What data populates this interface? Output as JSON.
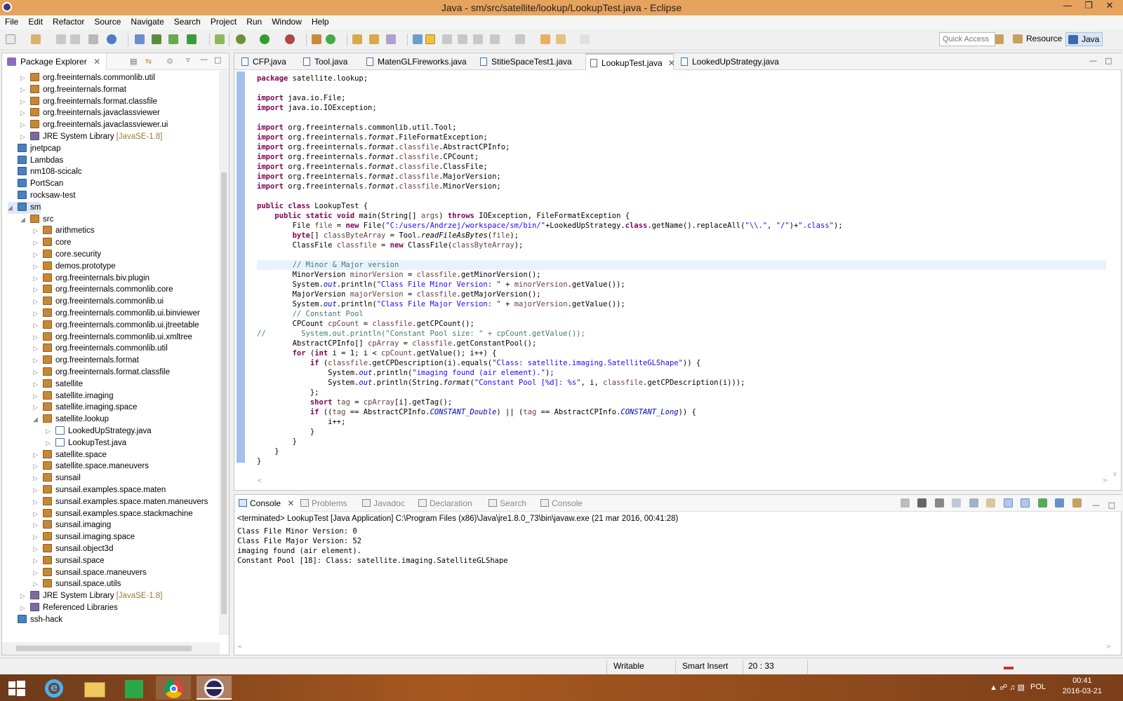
{
  "window": {
    "title": "Java - sm/src/satellite/lookup/LookupTest.java - Eclipse"
  },
  "menu": [
    "File",
    "Edit",
    "Refactor",
    "Source",
    "Navigate",
    "Search",
    "Project",
    "Run",
    "Window",
    "Help"
  ],
  "toolbar": {
    "quick_access_placeholder": "Quick Access",
    "perspectives": [
      "Resource",
      "Java"
    ]
  },
  "package_explorer": {
    "title": "Package Explorer",
    "items": [
      {
        "label": "org.freeinternals.commonlib.util",
        "level": 1,
        "icon": "package",
        "arrow": "right"
      },
      {
        "label": "org.freeinternals.format",
        "level": 1,
        "icon": "package",
        "arrow": "right"
      },
      {
        "label": "org.freeinternals.format.classfile",
        "level": 1,
        "icon": "package",
        "arrow": "right"
      },
      {
        "label": "org.freeinternals.javaclassviewer",
        "level": 1,
        "icon": "package",
        "arrow": "right"
      },
      {
        "label": "org.freeinternals.javaclassviewer.ui",
        "level": 1,
        "icon": "package",
        "arrow": "right"
      },
      {
        "label": "JRE System Library",
        "suffix": "[JavaSE-1.8]",
        "level": 1,
        "icon": "jar",
        "arrow": "right"
      },
      {
        "label": "jnetpcap",
        "level": 0,
        "icon": "project",
        "arrow": ""
      },
      {
        "label": "Lambdas",
        "level": 0,
        "icon": "project",
        "arrow": ""
      },
      {
        "label": "nm108-scicalc",
        "level": 0,
        "icon": "project",
        "arrow": ""
      },
      {
        "label": "PortScan",
        "level": 0,
        "icon": "project",
        "arrow": ""
      },
      {
        "label": "rocksaw-test",
        "level": 0,
        "icon": "project",
        "arrow": ""
      },
      {
        "label": "sm",
        "level": 0,
        "icon": "project",
        "arrow": "down"
      },
      {
        "label": "src",
        "level": 1,
        "icon": "package",
        "arrow": "down"
      },
      {
        "label": "arithmetics",
        "level": 2,
        "icon": "package",
        "arrow": "right"
      },
      {
        "label": "core",
        "level": 2,
        "icon": "package",
        "arrow": "right"
      },
      {
        "label": "core.security",
        "level": 2,
        "icon": "package",
        "arrow": "right"
      },
      {
        "label": "demos.prototype",
        "level": 2,
        "icon": "package",
        "arrow": "right"
      },
      {
        "label": "org.freeinternals.biv.plugin",
        "level": 2,
        "icon": "package",
        "arrow": "right"
      },
      {
        "label": "org.freeinternals.commonlib.core",
        "level": 2,
        "icon": "package",
        "arrow": "right"
      },
      {
        "label": "org.freeinternals.commonlib.ui",
        "level": 2,
        "icon": "package",
        "arrow": "right"
      },
      {
        "label": "org.freeinternals.commonlib.ui.binviewer",
        "level": 2,
        "icon": "package",
        "arrow": "right"
      },
      {
        "label": "org.freeinternals.commonlib.ui.jtreetable",
        "level": 2,
        "icon": "package",
        "arrow": "right"
      },
      {
        "label": "org.freeinternals.commonlib.ui.xmltree",
        "level": 2,
        "icon": "package",
        "arrow": "right"
      },
      {
        "label": "org.freeinternals.commonlib.util",
        "level": 2,
        "icon": "package",
        "arrow": "right"
      },
      {
        "label": "org.freeinternals.format",
        "level": 2,
        "icon": "package",
        "arrow": "right"
      },
      {
        "label": "org.freeinternals.format.classfile",
        "level": 2,
        "icon": "package",
        "arrow": "right"
      },
      {
        "label": "satellite",
        "level": 2,
        "icon": "package",
        "arrow": "right"
      },
      {
        "label": "satellite.imaging",
        "level": 2,
        "icon": "package",
        "arrow": "right"
      },
      {
        "label": "satellite.imaging.space",
        "level": 2,
        "icon": "package",
        "arrow": "right"
      },
      {
        "label": "satellite.lookup",
        "level": 2,
        "icon": "package",
        "arrow": "down"
      },
      {
        "label": "LookedUpStrategy.java",
        "level": 3,
        "icon": "file",
        "arrow": "right"
      },
      {
        "label": "LookupTest.java",
        "level": 3,
        "icon": "file",
        "arrow": "right"
      },
      {
        "label": "satellite.space",
        "level": 2,
        "icon": "package",
        "arrow": "right"
      },
      {
        "label": "satellite.space.maneuvers",
        "level": 2,
        "icon": "package",
        "arrow": "right"
      },
      {
        "label": "sunsail",
        "level": 2,
        "icon": "package",
        "arrow": "right"
      },
      {
        "label": "sunsail.examples.space.maten",
        "level": 2,
        "icon": "package",
        "arrow": "right"
      },
      {
        "label": "sunsail.examples.space.maten.maneuvers",
        "level": 2,
        "icon": "package",
        "arrow": "right"
      },
      {
        "label": "sunsail.examples.space.stackmachine",
        "level": 2,
        "icon": "package",
        "arrow": "right"
      },
      {
        "label": "sunsail.imaging",
        "level": 2,
        "icon": "package",
        "arrow": "right"
      },
      {
        "label": "sunsail.imaging.space",
        "level": 2,
        "icon": "package",
        "arrow": "right"
      },
      {
        "label": "sunsail.object3d",
        "level": 2,
        "icon": "package",
        "arrow": "right"
      },
      {
        "label": "sunsail.space",
        "level": 2,
        "icon": "package",
        "arrow": "right"
      },
      {
        "label": "sunsail.space.maneuvers",
        "level": 2,
        "icon": "package",
        "arrow": "right"
      },
      {
        "label": "sunsail.space.utils",
        "level": 2,
        "icon": "package",
        "arrow": "right"
      },
      {
        "label": "JRE System Library",
        "suffix": "[JavaSE-1.8]",
        "level": 1,
        "icon": "jar",
        "arrow": "right"
      },
      {
        "label": "Referenced Libraries",
        "level": 1,
        "icon": "jar",
        "arrow": "right"
      },
      {
        "label": "ssh-hack",
        "level": 0,
        "icon": "project",
        "arrow": ""
      }
    ]
  },
  "editor": {
    "tabs": [
      "CFP.java",
      "Tool.java",
      "MatenGLFireworks.java",
      "StitieSpaceTest1.java",
      "LookupTest.java",
      "LookedUpStrategy.java"
    ],
    "active_tab": "LookupTest.java",
    "lines": [
      "package satellite.lookup;",
      "",
      "import java.io.File;",
      "import java.io.IOException;",
      "",
      "import org.freeinternals.commonlib.util.Tool;",
      "import org.freeinternals.format.FileFormatException;",
      "import org.freeinternals.format.classfile.AbstractCPInfo;",
      "import org.freeinternals.format.classfile.CPCount;",
      "import org.freeinternals.format.classfile.ClassFile;",
      "import org.freeinternals.format.classfile.MajorVersion;",
      "import org.freeinternals.format.classfile.MinorVersion;",
      "",
      "public class LookupTest {",
      "    public static void main(String[] args) throws IOException, FileFormatException {",
      "        File file = new File(\"C:/users/Andrzej/workspace/sm/bin/\"+LookedUpStrategy.class.getName().replaceAll(\"\\\\.\", \"/\")+\".class\");",
      "        byte[] classByteArray = Tool.readFileAsBytes(file);",
      "        ClassFile classfile = new ClassFile(classByteArray);",
      "",
      "        // Minor & Major version",
      "        MinorVersion minorVersion = classfile.getMinorVersion();",
      "        System.out.println(\"Class File Minor Version: \" + minorVersion.getValue());",
      "        MajorVersion majorVersion = classfile.getMajorVersion();",
      "        System.out.println(\"Class File Major Version: \" + majorVersion.getValue());",
      "        // Constant Pool",
      "        CPCount cpCount = classfile.getCPCount();",
      "//        System.out.println(\"Constant Pool size: \" + cpCount.getValue());",
      "        AbstractCPInfo[] cpArray = classfile.getConstantPool();",
      "        for (int i = 1; i < cpCount.getValue(); i++) {",
      "            if (classfile.getCPDescription(i).equals(\"Class: satellite.imaging.SatelliteGLShape\")) {",
      "                System.out.println(\"imaging found (air element).\");",
      "                System.out.println(String.format(\"Constant Pool [%d]: %s\", i, classfile.getCPDescription(i)));",
      "            };",
      "            short tag = cpArray[i].getTag();",
      "            if ((tag == AbstractCPInfo.CONSTANT_Double) || (tag == AbstractCPInfo.CONSTANT_Long)) {",
      "                i++;",
      "            }",
      "        }",
      "    }",
      "}"
    ]
  },
  "console": {
    "tabs": [
      "Console",
      "Problems",
      "Javadoc",
      "Declaration",
      "Search",
      "Console"
    ],
    "status": "<terminated> LookupTest [Java Application] C:\\Program Files (x86)\\Java\\jre1.8.0_73\\bin\\javaw.exe (21 mar 2016, 00:41:28)",
    "output": [
      "Class File Minor Version: 0",
      "Class File Major Version: 52",
      "imaging found (air element).",
      "Constant Pool [18]: Class: satellite.imaging.SatelliteGLShape"
    ]
  },
  "statusbar": {
    "writable": "Writable",
    "insert_mode": "Smart Insert",
    "position": "20 : 33"
  },
  "taskbar": {
    "language": "POL",
    "time": "00:41",
    "date": "2016-03-21"
  }
}
